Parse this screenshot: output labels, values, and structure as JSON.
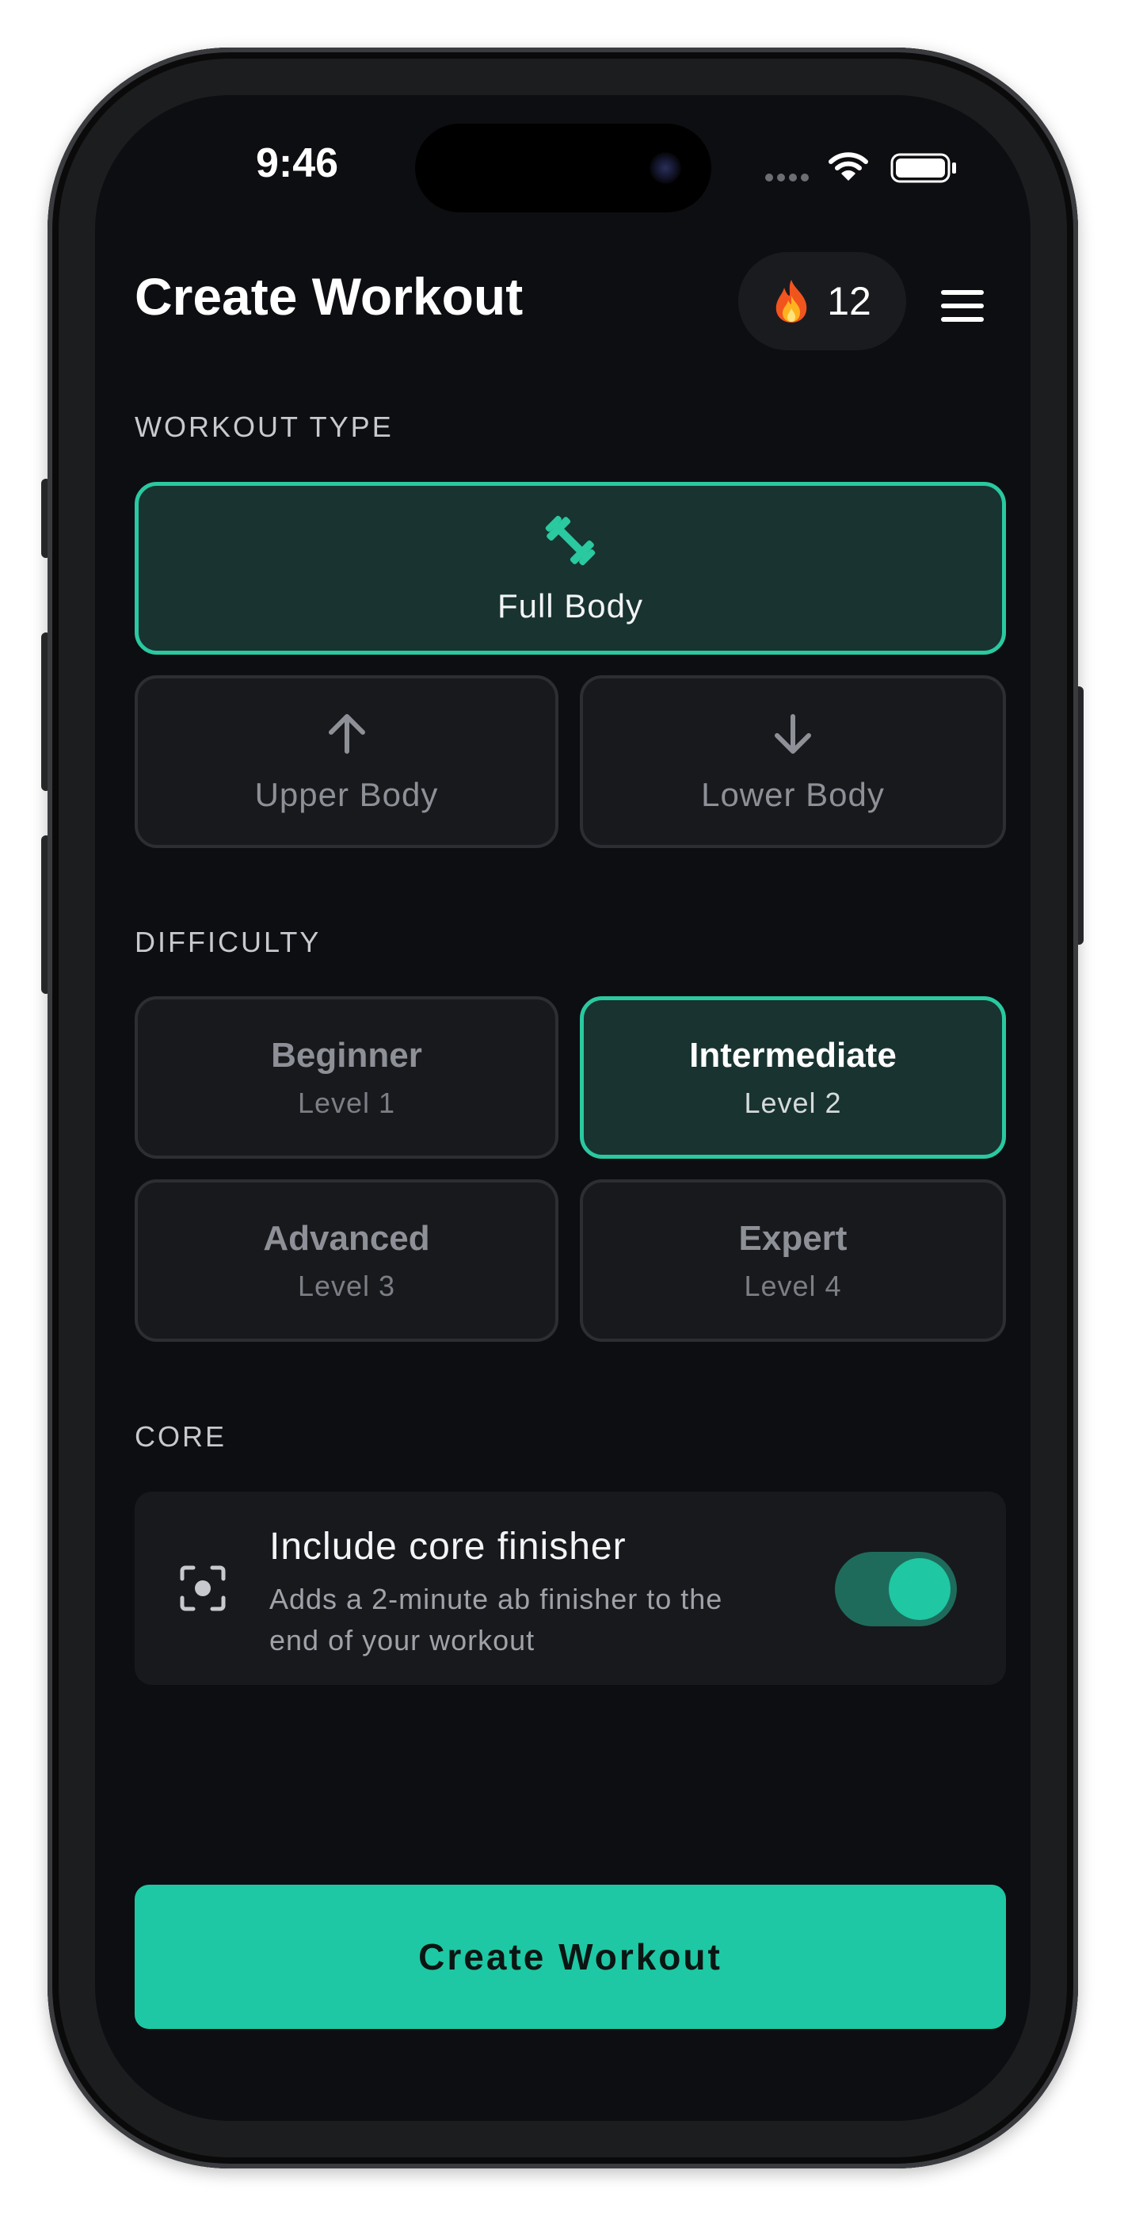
{
  "status_bar": {
    "time": "9:46"
  },
  "header": {
    "title": "Create Workout",
    "streak_emoji": "🔥",
    "streak_count": "12"
  },
  "workout_type": {
    "label": "WORKOUT TYPE",
    "options": [
      {
        "label": "Full Body",
        "icon": "dumbbell-icon",
        "selected": true
      },
      {
        "label": "Upper Body",
        "icon": "arrow-up-icon",
        "selected": false
      },
      {
        "label": "Lower Body",
        "icon": "arrow-down-icon",
        "selected": false
      }
    ]
  },
  "difficulty": {
    "label": "DIFFICULTY",
    "options": [
      {
        "title": "Beginner",
        "level": "Level 1",
        "selected": false
      },
      {
        "title": "Intermediate",
        "level": "Level 2",
        "selected": true
      },
      {
        "title": "Advanced",
        "level": "Level 3",
        "selected": false
      },
      {
        "title": "Expert",
        "level": "Level 4",
        "selected": false
      }
    ]
  },
  "core": {
    "label": "CORE",
    "title": "Include core finisher",
    "description": "Adds a 2-minute ab finisher to the end of your workout",
    "enabled": true
  },
  "create_button": {
    "label": "Create Workout"
  },
  "colors": {
    "accent": "#1ec8a4",
    "selected_border": "#2ac9a0",
    "selected_background": "#183330",
    "screen_background": "#0d0e11",
    "card_background": "#18191c"
  }
}
